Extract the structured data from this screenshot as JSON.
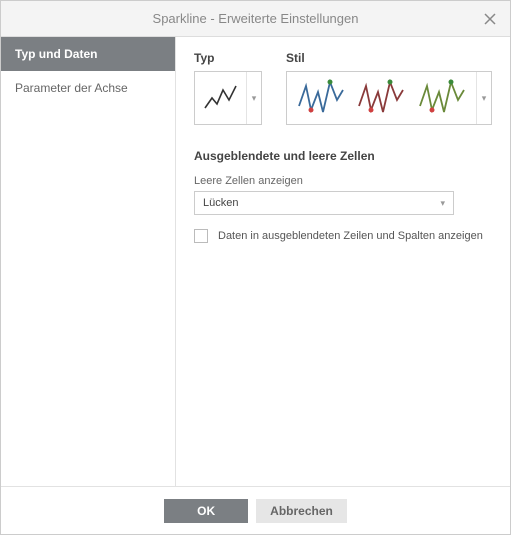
{
  "dialog": {
    "title": "Sparkline - Erweiterte Einstellungen"
  },
  "sidebar": {
    "tabs": [
      {
        "label": "Typ und Daten"
      },
      {
        "label": "Parameter der Achse"
      }
    ]
  },
  "content": {
    "type_label": "Typ",
    "style_label": "Stil",
    "section_title": "Ausgeblendete und leere Zellen",
    "empty_cells_label": "Leere Zellen anzeigen",
    "empty_cells_value": "Lücken",
    "checkbox_label": "Daten in ausgeblendeten Zeilen und Spalten anzeigen",
    "checkbox_checked": false,
    "type_icon": "line",
    "style_colors": [
      "#3a6a9a",
      "#8a3a3a",
      "#6a8a3a"
    ]
  },
  "footer": {
    "ok": "OK",
    "cancel": "Abbrechen"
  }
}
